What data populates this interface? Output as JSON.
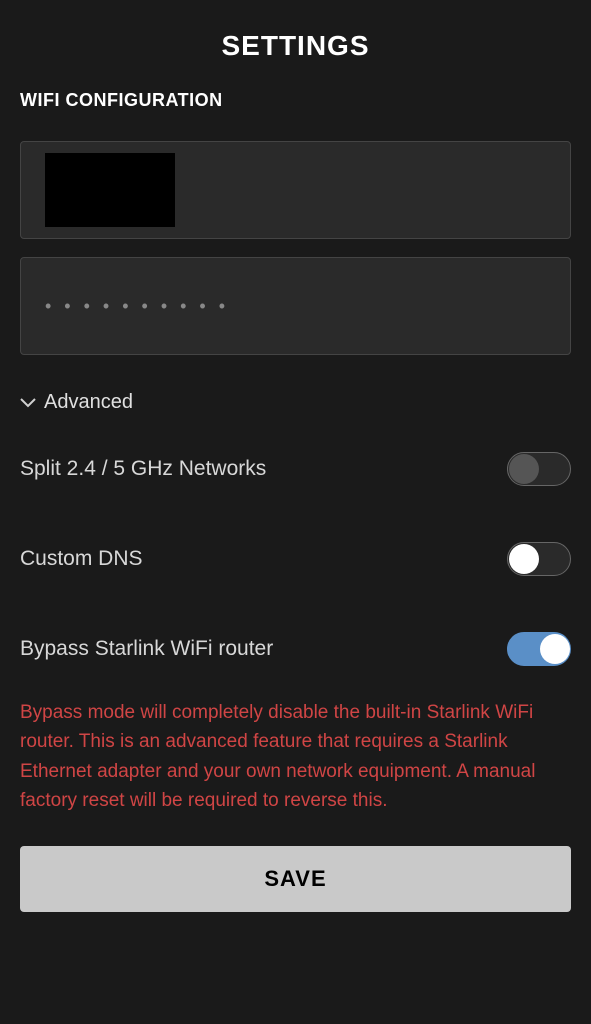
{
  "header": {
    "title": "SETTINGS"
  },
  "section": {
    "title": "WIFI CONFIGURATION"
  },
  "inputs": {
    "network_name": "",
    "password_display": "• • • • • • • • • •"
  },
  "advanced": {
    "label": "Advanced"
  },
  "toggles": {
    "split_networks": {
      "label": "Split 2.4 / 5 GHz Networks",
      "enabled": false
    },
    "custom_dns": {
      "label": "Custom DNS",
      "enabled": false
    },
    "bypass_router": {
      "label": "Bypass Starlink WiFi router",
      "enabled": true
    }
  },
  "warning": {
    "text": "Bypass mode will completely disable the built-in Starlink WiFi router. This is an advanced feature that requires a Starlink Ethernet adapter and your own network equipment. A manual factory reset will be required to reverse this."
  },
  "actions": {
    "save_label": "SAVE"
  }
}
